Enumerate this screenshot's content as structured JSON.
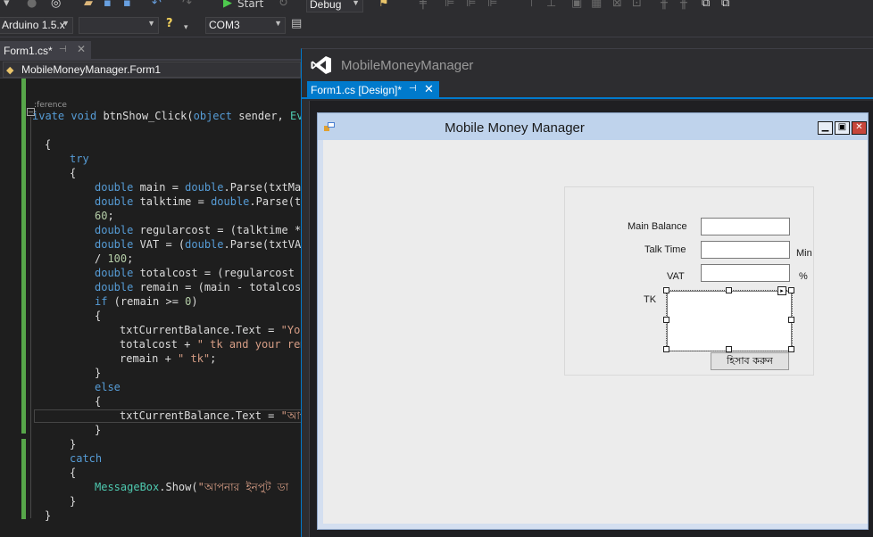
{
  "toolbar": {
    "start_label": "Start",
    "config_combo": "Debug",
    "board_combo": "Arduino 1.5.x",
    "blank_combo": "",
    "port_combo": "COM3"
  },
  "editor": {
    "tab_label": "Form1.cs*",
    "nav_class": "MobileMoneyManager.Form1",
    "reference_hint": ":ference",
    "lines": {
      "l1": "ivate void btnShow_Click(object sender, Eve",
      "l2": "{",
      "l3": "try",
      "l4": "{",
      "l5": "double main = double.Parse(txtMai",
      "l6": "double talktime = double.Parse(tx",
      "l7": "60;",
      "l8": "double regularcost = (talktime *",
      "l9": "double VAT = (double.Parse(txtVAT",
      "l10": "/ 100;",
      "l11": "double totalcost = (regularcost +",
      "l12": "double remain = (main - totalcost",
      "l13": "if (remain >= 0)",
      "l14": "{",
      "l15": "txtCurrentBalance.Text = \"You",
      "l16": "totalcost + \" tk and your rem",
      "l17": "remain + \" tk\";",
      "l18": "}",
      "l19": "else",
      "l20": "{",
      "l21": "txtCurrentBalance.Text = \"আপ",
      "l22": "}",
      "l23": "}",
      "l24": "catch",
      "l25": "{",
      "l26": "MessageBox.Show(\"আপনার ইনপুট ডা",
      "l27": "}",
      "l28": "}"
    }
  },
  "designer": {
    "window_title": "MobileMoneyManager",
    "tab_label": "Form1.cs [Design]*",
    "form": {
      "title": "Mobile Money Manager",
      "labels": {
        "main_balance": "Main Balance",
        "talk_time": "Talk Time",
        "min_unit": "Min",
        "vat": "VAT",
        "percent_unit": "%",
        "tk": "TK"
      },
      "calc_button": "হিসাব করুন"
    }
  },
  "colors": {
    "vs_accent": "#007acc",
    "editor_bg": "#1e1e1e",
    "keyword": "#569cd6",
    "type": "#4ec9b0",
    "string": "#d69d85",
    "changed_margin": "#57a64a",
    "form_titlebar": "#bfd3ec"
  }
}
